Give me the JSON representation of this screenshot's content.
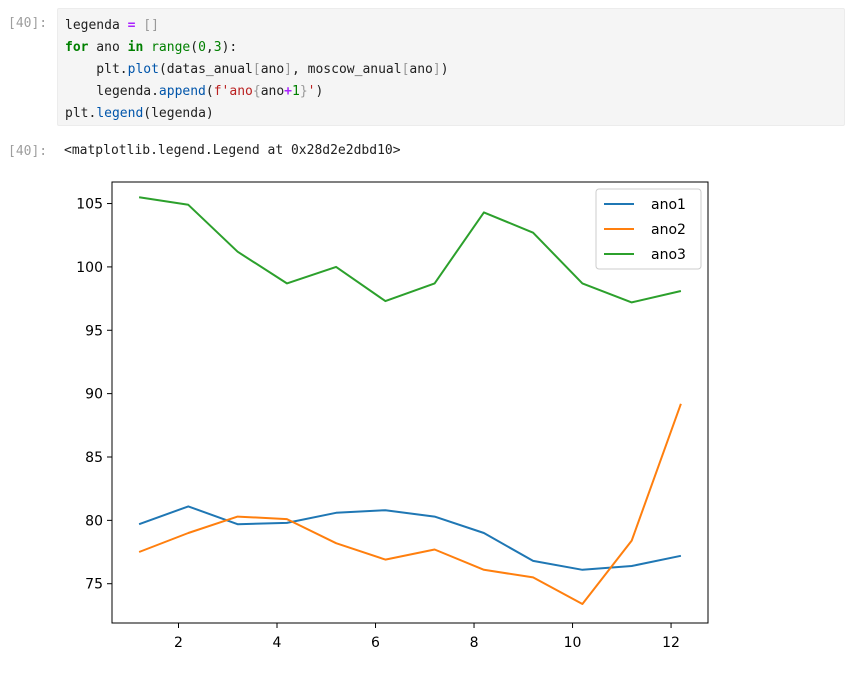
{
  "cells": [
    {
      "prompt": "[40]:",
      "code_lines": [
        [
          [
            "legenda ",
            ""
          ],
          [
            "=",
            "op"
          ],
          [
            " ",
            ""
          ],
          [
            "[]",
            "faint"
          ]
        ],
        [
          [
            "for",
            "kw"
          ],
          [
            " ano ",
            ""
          ],
          [
            "in",
            "kw"
          ],
          [
            " ",
            ""
          ],
          [
            "range",
            "bi"
          ],
          [
            "(",
            ""
          ],
          [
            "0",
            "num"
          ],
          [
            ",",
            ""
          ],
          [
            "3",
            "num"
          ],
          [
            "):",
            ""
          ]
        ],
        [
          [
            "    plt.",
            ""
          ],
          [
            "plot",
            "attr"
          ],
          [
            "(datas_anual",
            ""
          ],
          [
            "[",
            "faint"
          ],
          [
            "ano",
            ""
          ],
          [
            "]",
            "faint"
          ],
          [
            ", moscow_anual",
            ""
          ],
          [
            "[",
            "faint"
          ],
          [
            "ano",
            ""
          ],
          [
            "]",
            "faint"
          ],
          [
            ")",
            ""
          ]
        ],
        [
          [
            "    legenda.",
            ""
          ],
          [
            "append",
            "attr"
          ],
          [
            "(",
            ""
          ],
          [
            "f'ano",
            "str"
          ],
          [
            "{",
            "faint"
          ],
          [
            "ano",
            ""
          ],
          [
            "+",
            "op"
          ],
          [
            "1",
            "num"
          ],
          [
            "}",
            "faint"
          ],
          [
            "'",
            "str"
          ],
          [
            ")",
            ""
          ]
        ],
        [
          [
            "plt.",
            ""
          ],
          [
            "legend",
            "attr"
          ],
          [
            "(legenda)",
            ""
          ]
        ]
      ]
    },
    {
      "prompt": "[40]:",
      "output_text": "<matplotlib.legend.Legend at 0x28d2e2dbd10>"
    }
  ],
  "chart_data": {
    "type": "line",
    "xlim": [
      0.65,
      12.75
    ],
    "ylim": [
      71.9,
      106.7
    ],
    "xticks": [
      2,
      4,
      6,
      8,
      10,
      12
    ],
    "yticks": [
      75,
      80,
      85,
      90,
      95,
      100,
      105
    ],
    "xtick_labels": [
      "2",
      "4",
      "6",
      "8",
      "10",
      "12"
    ],
    "ytick_labels": [
      "75",
      "80",
      "85",
      "90",
      "95",
      "100",
      "105"
    ],
    "x": [
      1.2,
      2.2,
      3.2,
      4.2,
      5.2,
      6.2,
      7.2,
      8.2,
      9.2,
      10.2,
      11.2,
      12.2
    ],
    "series": [
      {
        "name": "ano1",
        "color": "#1f77b4",
        "values": [
          79.7,
          81.1,
          79.7,
          79.8,
          80.6,
          80.8,
          80.3,
          79.0,
          76.8,
          76.1,
          76.4,
          77.2
        ]
      },
      {
        "name": "ano2",
        "color": "#ff7f0e",
        "values": [
          77.5,
          79.0,
          80.3,
          80.1,
          78.2,
          76.9,
          77.7,
          76.1,
          75.5,
          73.4,
          78.4,
          89.2
        ]
      },
      {
        "name": "ano3",
        "color": "#2ca02c",
        "values": [
          105.5,
          104.9,
          101.2,
          98.7,
          100.0,
          97.3,
          98.7,
          104.3,
          102.7,
          98.7,
          97.2,
          98.1
        ]
      }
    ],
    "legend": "top-right",
    "grid": false
  }
}
